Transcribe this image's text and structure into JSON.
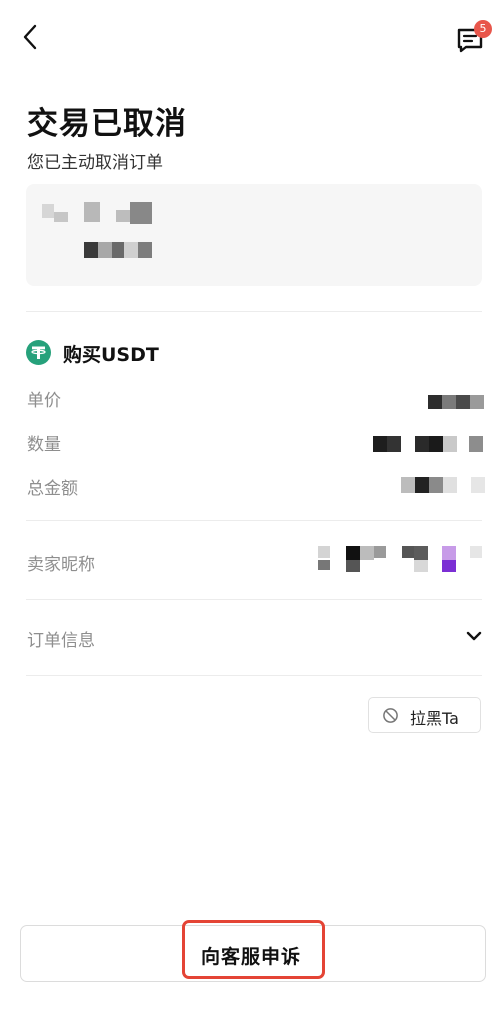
{
  "nav": {
    "message_badge_count": "5",
    "back_icon": "chevron-left-icon",
    "message_icon": "message-icon"
  },
  "status": {
    "title": "交易已取消",
    "subtitle": "您已主动取消订单"
  },
  "order": {
    "asset_icon": "usdt-icon",
    "asset_color": "#26a17b",
    "title": "购买USDT",
    "fields": [
      {
        "label": "单价"
      },
      {
        "label": "数量"
      },
      {
        "label": "总金额"
      }
    ],
    "seller_label": "卖家昵称",
    "order_info_label": "订单信息",
    "expand_icon": "chevron-down-icon"
  },
  "actions": {
    "block_label": "拉黑Ta",
    "block_icon": "block-icon",
    "appeal_label": "向客服申诉",
    "highlight_color": "#e44435"
  }
}
